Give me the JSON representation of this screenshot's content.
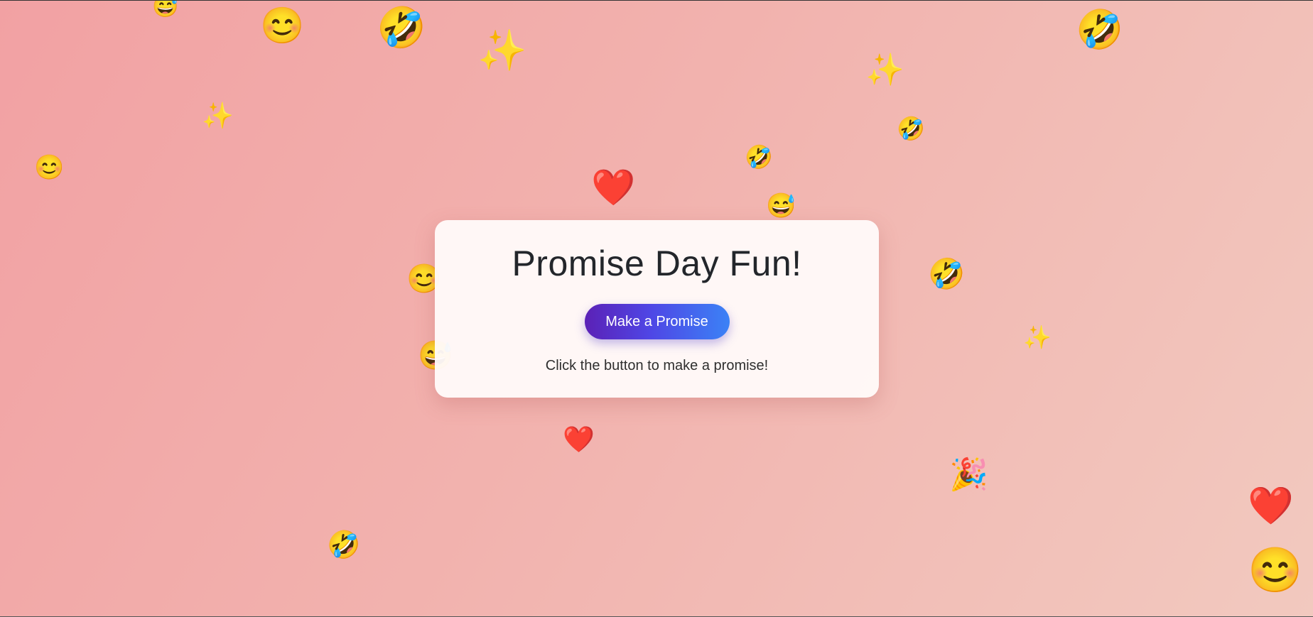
{
  "card": {
    "title": "Promise Day Fun!",
    "button_label": "Make a Promise",
    "status_text": "Click the button to make a promise!"
  },
  "decorations": {
    "emoji_kinds": [
      "grinning-sweat-icon",
      "smiling-face-icon",
      "rolling-laughing-icon",
      "sparkles-icon",
      "red-heart-icon",
      "party-popper-icon"
    ],
    "glyphs": {
      "grin": "😅",
      "smile": "😊",
      "rofl": "🤣",
      "sparkles": "✨",
      "heart": "❤️",
      "party": "🎉"
    }
  },
  "colors": {
    "background_start": "#f2a1a3",
    "background_end": "#f2c9bf",
    "button_start": "#5b21b6",
    "button_end": "#3b82f6",
    "title": "#23262b"
  }
}
